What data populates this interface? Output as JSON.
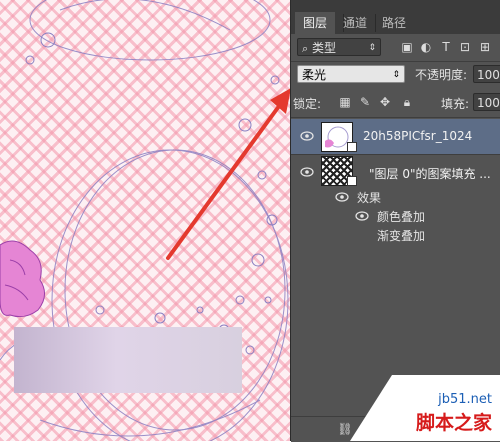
{
  "tabs": [
    {
      "label": "图层",
      "active": true
    },
    {
      "label": "通道",
      "active": false
    },
    {
      "label": "路径",
      "active": false
    }
  ],
  "filter": {
    "kind_label": "类型"
  },
  "blend_mode": {
    "value": "柔光"
  },
  "opacity": {
    "label": "不透明度:",
    "value": "100"
  },
  "lock": {
    "label": "锁定:"
  },
  "fill": {
    "label": "填充:",
    "value": "100"
  },
  "layers": [
    {
      "name": "20h58PICfsr_1024",
      "selected": true
    },
    {
      "name": "\"图层 0\"的图案填充 ...",
      "selected": false
    }
  ],
  "effects": {
    "label": "效果",
    "items": [
      "颜色叠加",
      "渐变叠加"
    ]
  },
  "watermark": {
    "line1": "jb51.net",
    "line2": "脚本之家"
  },
  "colors": {
    "panel": "#535353",
    "selected_layer": "#5d6d87",
    "arrow": "#e4392e",
    "pattern": "#f396aa"
  }
}
